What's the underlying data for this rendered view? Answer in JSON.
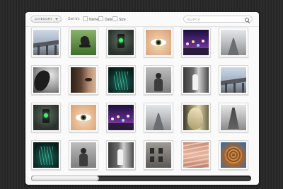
{
  "toolbar": {
    "category_label": "CATEGORY",
    "sort_by_label": "Sort by:",
    "sort_options": [
      {
        "label": "Name"
      },
      {
        "label": "Date"
      },
      {
        "label": "Size"
      }
    ],
    "search_placeholder": "SEARCH"
  },
  "gallery": {
    "thumbnails": [
      {
        "subject": "bridge"
      },
      {
        "subject": "grass"
      },
      {
        "subject": "traffic-light"
      },
      {
        "subject": "eye"
      },
      {
        "subject": "city-night"
      },
      {
        "subject": "road"
      },
      {
        "subject": "dark-hair"
      },
      {
        "subject": "face-closeup"
      },
      {
        "subject": "plant"
      },
      {
        "subject": "bw-girl"
      },
      {
        "subject": "bw-doorway"
      },
      {
        "subject": "bridge"
      },
      {
        "subject": "traffic-light"
      },
      {
        "subject": "eye"
      },
      {
        "subject": "city-night"
      },
      {
        "subject": "road"
      },
      {
        "subject": "blond-hair"
      },
      {
        "subject": "smoke"
      },
      {
        "subject": "plant"
      },
      {
        "subject": "bw-girl"
      },
      {
        "subject": "bw-doorway"
      },
      {
        "subject": "bw-facade"
      },
      {
        "subject": "jeans"
      },
      {
        "subject": "curly-hair"
      }
    ]
  },
  "scrollbar": {
    "position": 0.31
  },
  "colors": {
    "panel": "#fafafa",
    "background": "#2a2a2a",
    "scroll_track": "#3b3b3b"
  }
}
